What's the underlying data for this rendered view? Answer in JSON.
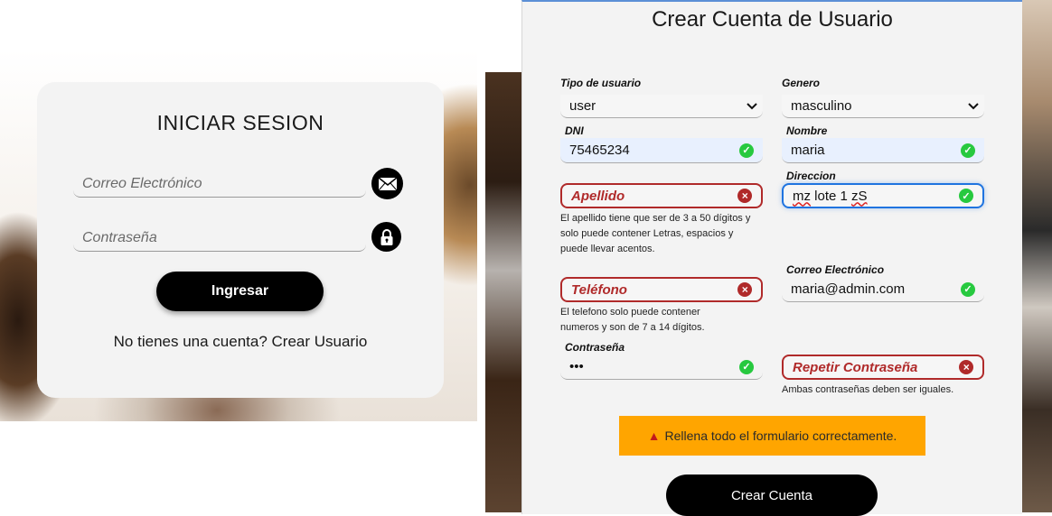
{
  "login": {
    "title": "INICIAR SESION",
    "email_placeholder": "Correo Electrónico",
    "password_placeholder": "Contraseña",
    "submit_label": "Ingresar",
    "no_account_text": "No tienes una cuenta?",
    "create_link": "Crear Usuario"
  },
  "register": {
    "title": "Crear Cuenta de Usuario",
    "tipo_label": "Tipo de usuario",
    "tipo_value": "user",
    "genero_label": "Genero",
    "genero_value": "masculino",
    "dni_label": "DNI",
    "dni_value": "75465234",
    "nombre_label": "Nombre",
    "nombre_value": "maria",
    "apellido_placeholder": "Apellido",
    "apellido_error": "El apellido tiene que ser de 3 a 50 dígitos y solo puede contener Letras, espacios y puede llevar acentos.",
    "direccion_label": "Direccion",
    "direccion_value_a": "mz",
    "direccion_value_b": " lote 1 ",
    "direccion_value_c": "zS",
    "telefono_placeholder": "Teléfono",
    "telefono_error": "El telefono solo puede contener numeros y son de 7 a 14 dígitos.",
    "correo_label": "Correo Electrónico",
    "correo_value": "maria@admin.com",
    "contrasena_label": "Contraseña",
    "contrasena_value": "•••",
    "repetir_placeholder": "Repetir Contraseña",
    "repetir_error": "Ambas contraseñas deben ser iguales.",
    "alert_text": "Rellena todo el formulario correctamente.",
    "submit_label": "Crear Cuenta"
  },
  "icons": {
    "email": "envelope-icon",
    "password": "lock-icon",
    "valid": "check-circle-icon",
    "invalid": "x-circle-icon",
    "warning": "warning-icon"
  },
  "colors": {
    "error": "#b02a2a",
    "valid": "#27c93f",
    "focus": "#1f74e0",
    "alert": "#ffa500"
  }
}
